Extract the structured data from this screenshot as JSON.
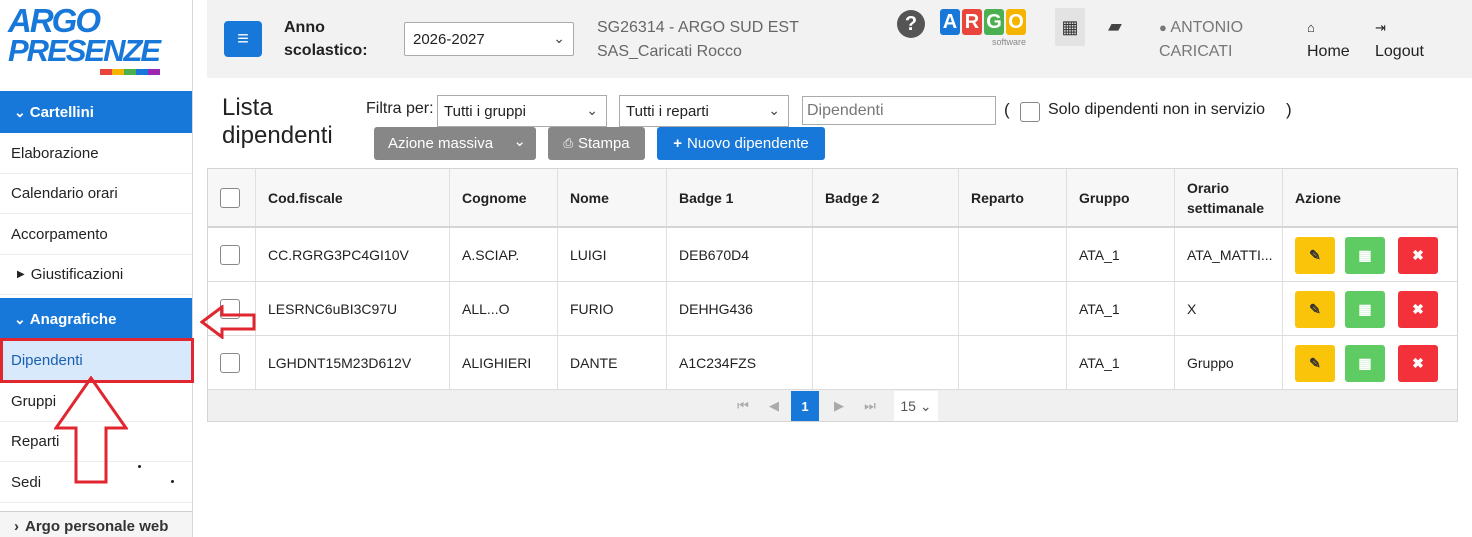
{
  "sidebar": {
    "logo_line1": "ARGO",
    "logo_line2": "PRESENZE",
    "sections": [
      {
        "label": "Cartellini",
        "items": [
          "Elaborazione",
          "Calendario orari",
          "Accorpamento",
          "Giustificazioni"
        ]
      },
      {
        "label": "Anagrafiche",
        "items": [
          "Dipendenti",
          "Gruppi",
          "Reparti",
          "Sedi"
        ]
      }
    ],
    "bottom_section": "Argo personale web",
    "active_item": "Dipendenti"
  },
  "topbar": {
    "anno_label_1": "Anno",
    "anno_label_2": "scolastico:",
    "year_value": "2026-2027",
    "school_line1": "SG26314 - ARGO SUD EST",
    "school_line2": "SAS_Caricati Rocco",
    "argo_letters": [
      "A",
      "R",
      "G",
      "O"
    ],
    "argo_colors": [
      "#1778d9",
      "#e8453c",
      "#4caf50",
      "#f4b400"
    ],
    "argo_sub": "software",
    "user_line1": "ANTONIO",
    "user_line2": "CARICATI",
    "home": "Home",
    "logout": "Logout"
  },
  "content": {
    "title_line1": "Lista",
    "title_line2": "dipendenti",
    "filter_label": "Filtra per:",
    "group_select": "Tutti i gruppi",
    "dept_select": "Tutti i reparti",
    "search_placeholder": "Dipendenti",
    "paren_open": "(",
    "paren_close": ")",
    "solo_label": "Solo dipendenti non in servizio",
    "btn_mass": "Azione massiva",
    "btn_print": "Stampa",
    "btn_new": "Nuovo dipendente"
  },
  "table": {
    "headers": [
      "Cod.fiscale",
      "Cognome",
      "Nome",
      "Badge 1",
      "Badge 2",
      "Reparto",
      "Gruppo",
      "Orario settimanale",
      "Azione"
    ],
    "rows": [
      [
        "CC.RGRG3PC4GI10V",
        "A.SCIAP.",
        "LUIGI",
        "DEB670D4",
        "",
        "",
        "ATA_1",
        "ATA_MATTI..."
      ],
      [
        "LESRNC6uBI3C97U",
        "ALL...O",
        "FURIO",
        "DEHHG436",
        "",
        "",
        "ATA_1",
        "X"
      ],
      [
        "LGHDNT15M23D612V",
        "ALIGHIERI",
        "DANTE",
        "A1C234FZS",
        "",
        "",
        "ATA_1",
        "Gruppo"
      ]
    ],
    "pager": {
      "first": "⏮",
      "prev": "◀",
      "current": "1",
      "next": "▶",
      "last": "⏭",
      "per_page": "15"
    }
  },
  "colors": {
    "primary": "#1778d9",
    "annotation_red": "#e0262f"
  }
}
